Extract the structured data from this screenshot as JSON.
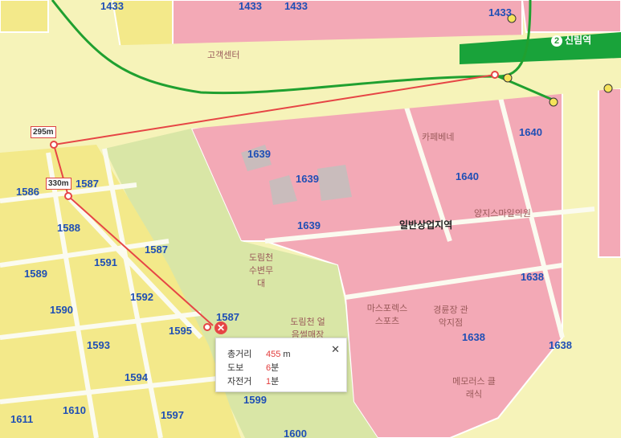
{
  "map": {
    "station_name": "신림역",
    "station_line": "2",
    "zone_label": "일반상업지역",
    "distance_labels": [
      "295m",
      "330m"
    ],
    "block_numbers": [
      "1433",
      "1433",
      "1433",
      "1433",
      "1639",
      "1639",
      "1639",
      "1640",
      "1640",
      "1587",
      "1587",
      "1587",
      "1586",
      "1588",
      "1591",
      "1589",
      "1590",
      "1592",
      "1593",
      "1594",
      "1595",
      "1638",
      "1638",
      "1638",
      "1599",
      "1597",
      "1610",
      "1611",
      "1600"
    ],
    "place_labels": [
      "도림천 수변무대",
      "도림천 얼음썰매장",
      "경륜장 관악지점",
      "마스포렉스 스포츠",
      "메모러스 클래식",
      "카페베네",
      "양지스마일의원",
      "고객센터"
    ]
  },
  "popup": {
    "total_label": "총거리",
    "total_value": "455",
    "total_unit": "m",
    "walk_label": "도보",
    "walk_value": "6",
    "walk_unit": "분",
    "bike_label": "자전거",
    "bike_value": "1",
    "bike_unit": "분",
    "close_symbol": "✕"
  },
  "marker": {
    "end_symbol": "✕"
  },
  "colors": {
    "commercial": "#f3a9b6",
    "residential": "#f3e98a",
    "road": "#f6f3b9",
    "green_route": "#20a030",
    "subway": "#19a33a",
    "measure_line": "#e64545"
  }
}
